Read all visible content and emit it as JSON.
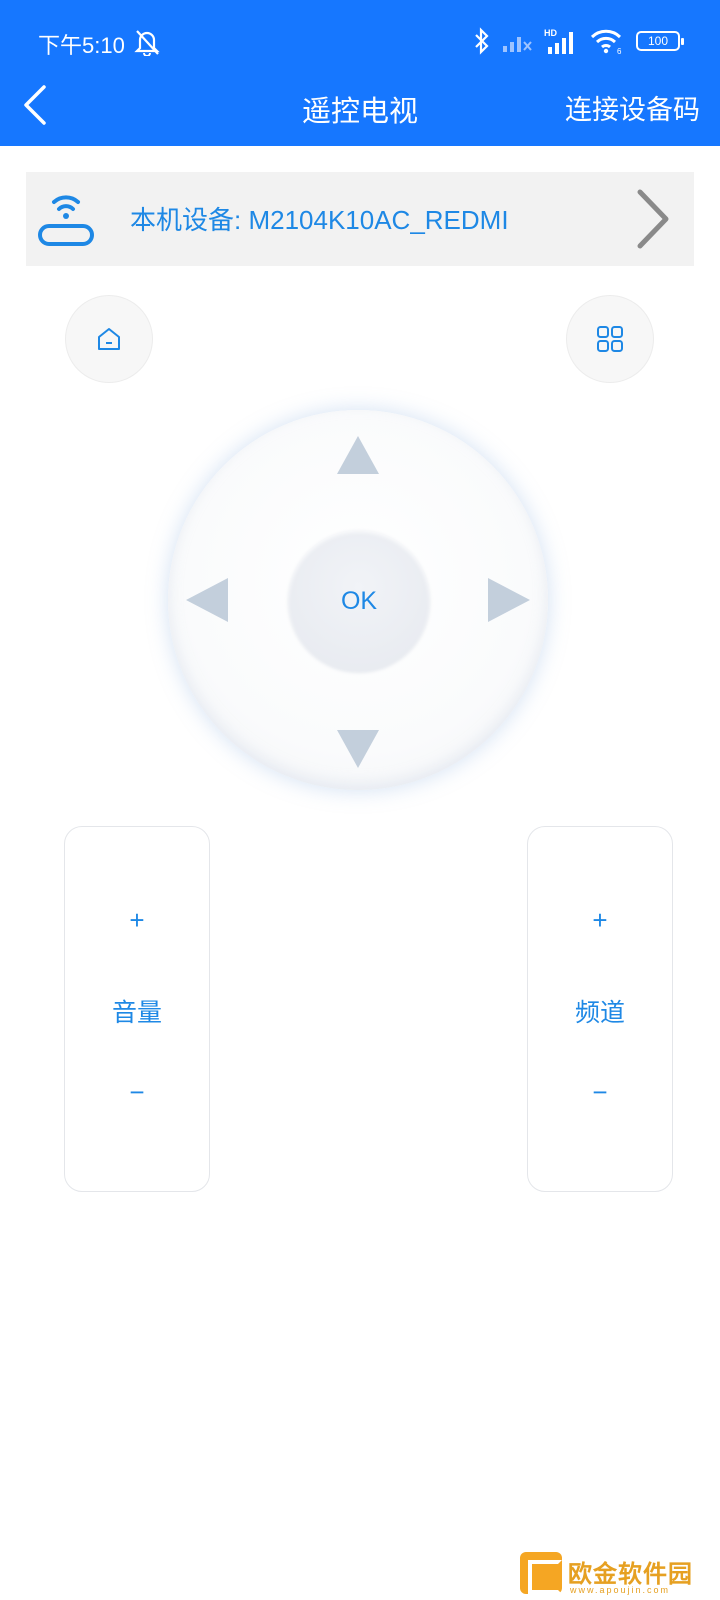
{
  "status_bar": {
    "time": "下午5:10",
    "battery": "100",
    "network_label": "HD"
  },
  "nav": {
    "title": "遥控电视",
    "action": "连接设备码"
  },
  "device": {
    "label": "本机设备: M2104K10AC_REDMI"
  },
  "remote": {
    "ok_label": "OK",
    "volume": {
      "plus": "+",
      "label": "音量",
      "minus": "−"
    },
    "channel": {
      "plus": "+",
      "label": "频道",
      "minus": "−"
    }
  },
  "watermark": {
    "name": "欧金软件园",
    "url": "www.apoujin.com"
  },
  "colors": {
    "primary": "#1677ff",
    "accent_text": "#1e88e5",
    "arrow": "#c3cfdc"
  }
}
